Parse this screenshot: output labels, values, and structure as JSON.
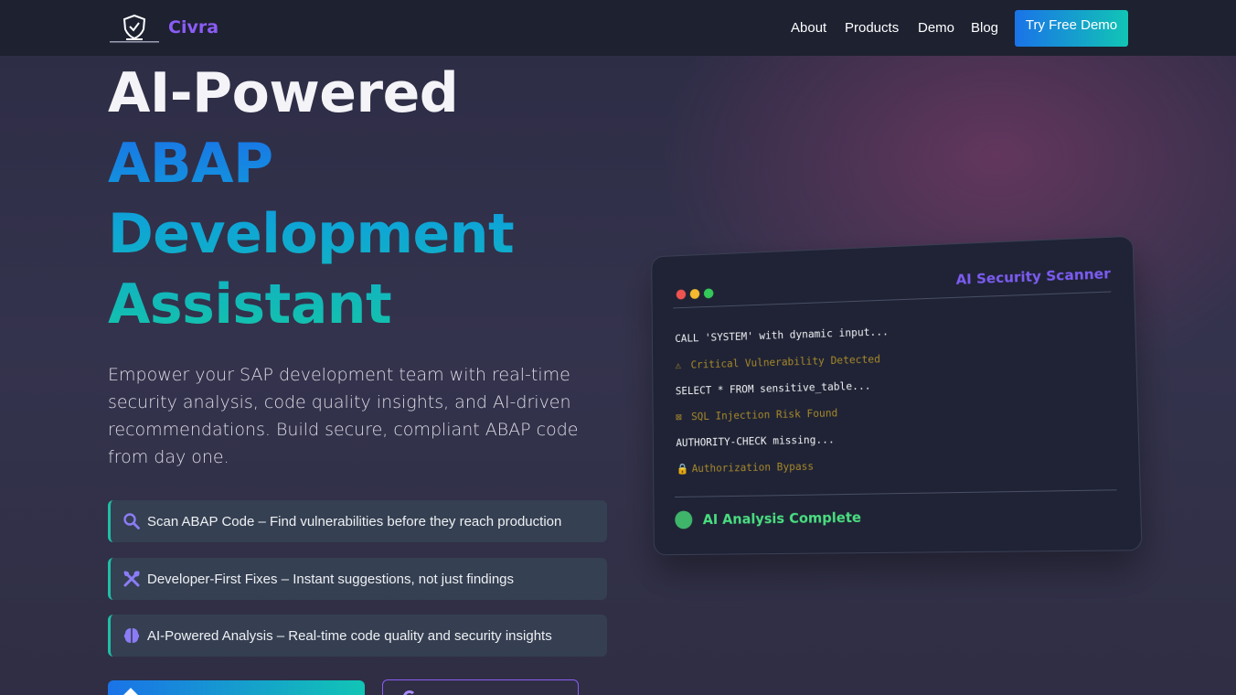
{
  "nav": {
    "brand": "Civra",
    "logo_tagline": "CIVRA",
    "links": [
      "About",
      "Products",
      "Demo",
      "Blog"
    ],
    "cta_label": "Try Free Demo"
  },
  "hero": {
    "title_line1": "AI-Powered",
    "title_line2": "ABAP",
    "title_line3": "Development",
    "title_line4": "Assistant",
    "subtitle": "Empower your SAP development team with real-time security analysis, code quality insights, and AI-driven recommendations. Build secure, compliant ABAP code from day one.",
    "features": [
      {
        "icon": "magnifier-icon",
        "text": "Scan ABAP Code – Find vulnerabilities before they reach production"
      },
      {
        "icon": "tools-icon",
        "text": "Developer-First Fixes – Instant suggestions, not just findings"
      },
      {
        "icon": "brain-icon",
        "text": "AI-Powered Analysis – Real-time code quality and security insights"
      }
    ]
  },
  "scanner": {
    "title": "AI Security Scanner",
    "lines": [
      {
        "text": "CALL 'SYSTEM' with dynamic input...",
        "type": "code"
      },
      {
        "text": "Critical Vulnerability Detected",
        "type": "warn",
        "icon": "warning-icon",
        "glyph": "⚠"
      },
      {
        "text": "SELECT * FROM sensitive_table...",
        "type": "code"
      },
      {
        "text": "SQL Injection Risk Found",
        "type": "warn",
        "icon": "error-box-icon",
        "glyph": "⊠"
      },
      {
        "text": "AUTHORITY-CHECK missing...",
        "type": "code"
      },
      {
        "text": "Authorization Bypass",
        "type": "warn",
        "icon": "lock-icon",
        "glyph": "🔒"
      }
    ],
    "status": "AI Analysis Complete"
  },
  "colors": {
    "accent_purple": "#8b5cf6",
    "gradient_start": "#1a73e8",
    "gradient_end": "#11c5b5",
    "success_green": "#4ade80",
    "warning_amber": "#a8892a",
    "dot_red": "#ef5350",
    "dot_yellow": "#f5b82e",
    "dot_green": "#34c759"
  }
}
